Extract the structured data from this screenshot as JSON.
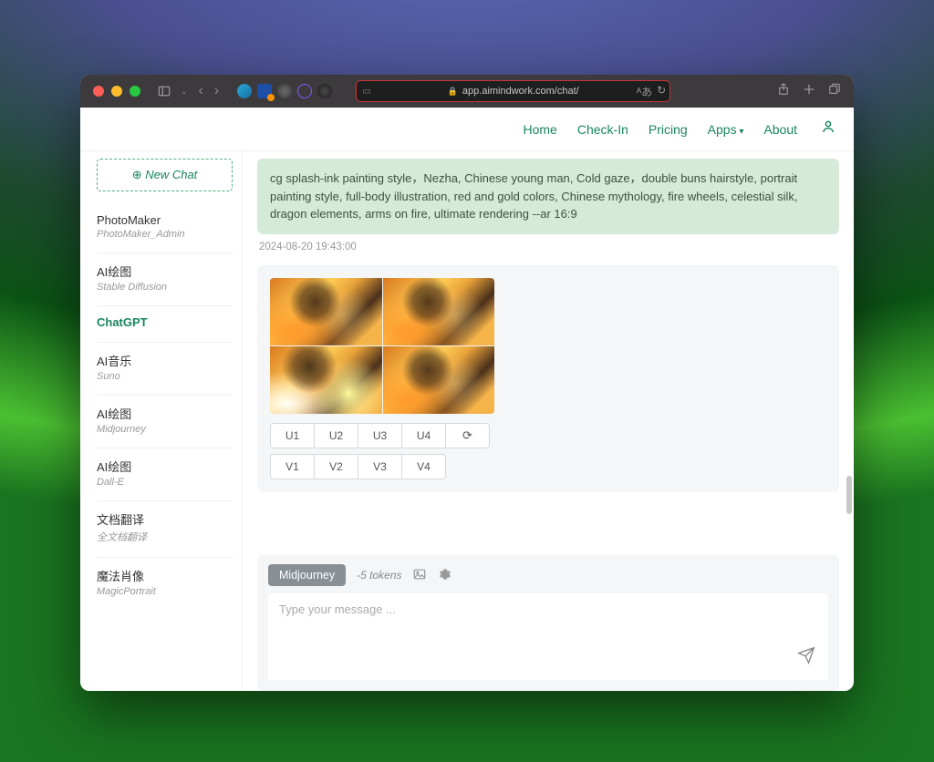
{
  "url": "app.aimindwork.com/chat/",
  "nav": {
    "home": "Home",
    "checkin": "Check-In",
    "pricing": "Pricing",
    "apps": "Apps",
    "about": "About"
  },
  "sidebar": {
    "new_chat": "New Chat",
    "items": [
      {
        "title": "PhotoMaker",
        "sub": "PhotoMaker_Admin"
      },
      {
        "title": "AI绘图",
        "sub": "Stable Diffusion"
      },
      {
        "title": "ChatGPT",
        "sub": ""
      },
      {
        "title": "AI音乐",
        "sub": "Suno"
      },
      {
        "title": "AI绘图",
        "sub": "Midjourney"
      },
      {
        "title": "AI绘图",
        "sub": "Dall-E"
      },
      {
        "title": "文档翻译",
        "sub": "全文档翻译"
      },
      {
        "title": "魔法肖像",
        "sub": "MagicPortrait"
      }
    ]
  },
  "chat": {
    "prompt": "cg splash-ink painting style，Nezha, Chinese young man, Cold gaze，double buns hairstyle, portrait painting style, full-body illustration, red and gold colors, Chinese mythology, fire wheels, celestial silk, dragon elements, arms on fire, ultimate rendering --ar 16:9",
    "timestamp": "2024-08-20 19:43:00",
    "u_buttons": [
      "U1",
      "U2",
      "U3",
      "U4"
    ],
    "v_buttons": [
      "V1",
      "V2",
      "V3",
      "V4"
    ]
  },
  "input": {
    "model": "Midjourney",
    "tokens": "-5 tokens",
    "placeholder": "Type your message ..."
  }
}
